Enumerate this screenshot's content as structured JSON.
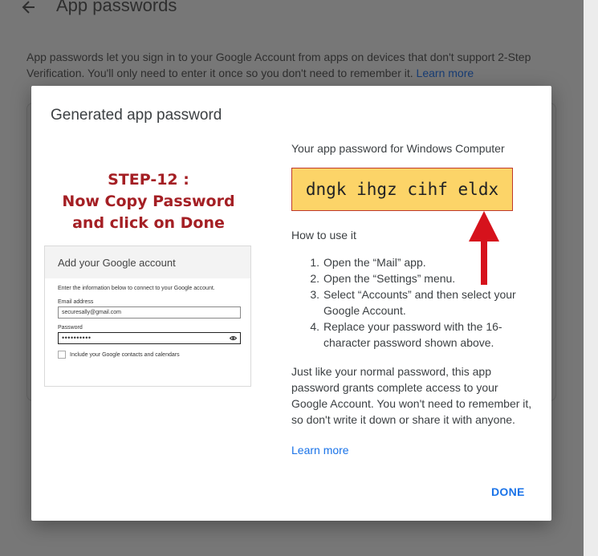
{
  "background": {
    "title": "App passwords",
    "description": "App passwords let you sign in to your Google Account from apps on devices that don't support 2-Step Verification. You'll only need to enter it once so you don't need to remember it.",
    "learn_more": "Learn more"
  },
  "dialog": {
    "title": "Generated app password",
    "annotation": {
      "line1": "STEP-12 :",
      "line2": "Now Copy Password",
      "line3": "and click on Done",
      "color": "#a41f24"
    },
    "example": {
      "title": "Add your Google account",
      "instructions": "Enter the information below to connect to your Google account.",
      "email_label": "Email address",
      "email_value": "securesally@gmail.com",
      "password_label": "Password",
      "password_value": "••••••••••",
      "checkbox_label": "Include your Google contacts and calendars"
    },
    "password_label": "Your app password for Windows Computer",
    "password": "dngk ihgz cihf eldx",
    "how_to_title": "How to use it",
    "steps": [
      {
        "num": "1.",
        "text": "Open the “Mail” app."
      },
      {
        "num": "2.",
        "text": "Open the “Settings” menu."
      },
      {
        "num": "3.",
        "text": "Select “Accounts” and then select your Google Account."
      },
      {
        "num": "4.",
        "text": "Replace your password with the 16-character password shown above."
      }
    ],
    "note": "Just like your normal password, this app password grants complete access to your Google Account. You won't need to remember it, so don't write it down or share it with anyone.",
    "learn_more": "Learn more",
    "done_label": "DONE"
  },
  "colors": {
    "accent": "#1a73e8",
    "password_highlight": "#fcd468",
    "arrow": "#d6121c"
  }
}
